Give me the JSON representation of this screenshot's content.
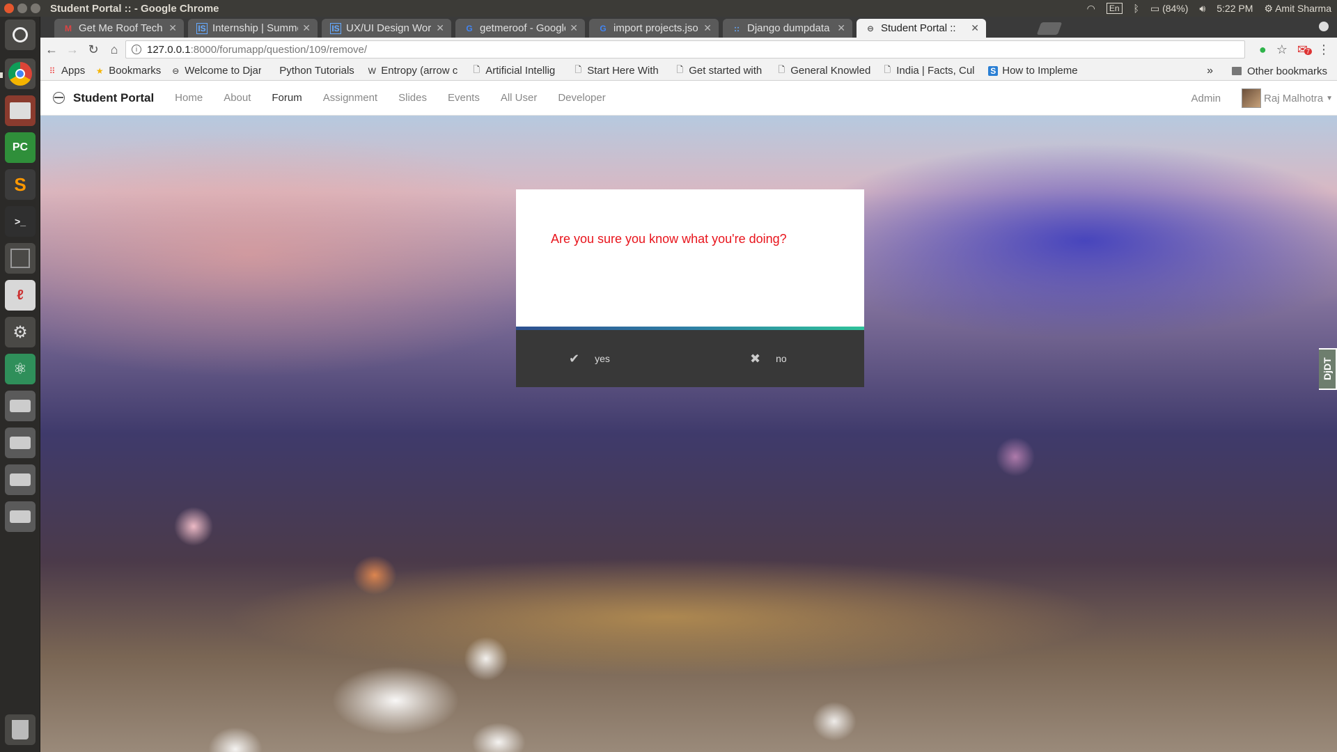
{
  "os": {
    "window_title": "Student Portal :: - Google Chrome",
    "battery": "(84%)",
    "keyboard": "En",
    "clock": "5:22 PM",
    "user": "Amit Sharma"
  },
  "tabs": [
    {
      "title": "Get Me Roof Tech A",
      "icon": "M"
    },
    {
      "title": "Internship | Summe",
      "icon": "IS"
    },
    {
      "title": "UX/UI Design Work",
      "icon": "IS"
    },
    {
      "title": "getmeroof - Google",
      "icon": "G"
    },
    {
      "title": "import projects.jso",
      "icon": "G"
    },
    {
      "title": "Django dumpdata",
      "icon": "::"
    },
    {
      "title": "Student Portal ::",
      "icon": "⊖"
    }
  ],
  "toolbar": {
    "url_host": "127.0.0.1",
    "url_path": ":8000/forumapp/question/109/remove/",
    "mail_badge": "7"
  },
  "bookmarks": {
    "items": [
      {
        "label": "Apps",
        "icon": "apps-icon"
      },
      {
        "label": "Bookmarks",
        "icon": "star-icon"
      },
      {
        "label": "Welcome to Djar",
        "icon": "globe-icon"
      },
      {
        "label": "Python Tutorials",
        "icon": "page-icon"
      },
      {
        "label": "Entropy (arrow c",
        "icon": "wikipedia-icon"
      },
      {
        "label": "Artificial Intellig",
        "icon": "page-icon"
      },
      {
        "label": "Start Here With",
        "icon": "page-icon"
      },
      {
        "label": "Get started with",
        "icon": "page-icon"
      },
      {
        "label": "General Knowled",
        "icon": "page-icon"
      },
      {
        "label": "India | Facts, Cul",
        "icon": "page-icon"
      },
      {
        "label": "How to Impleme",
        "icon": "s-icon"
      }
    ],
    "overflow": "»",
    "other": "Other bookmarks"
  },
  "navbar": {
    "brand": "Student Portal",
    "links": [
      "Home",
      "About",
      "Forum",
      "Assignment",
      "Slides",
      "Events",
      "All User",
      "Developer"
    ],
    "active": "Forum",
    "admin": "Admin",
    "user": "Raj Malhotra"
  },
  "dialog": {
    "message": "Are you sure you know what you're doing?",
    "yes_label": "yes",
    "no_label": "no"
  },
  "devtools_label": "DjDT",
  "colors": {
    "dialog_message": "#e8141c",
    "dialog_actions_bg": "#383838",
    "accent_gradient": [
      "#2d4f8f",
      "#2fc39a"
    ]
  }
}
